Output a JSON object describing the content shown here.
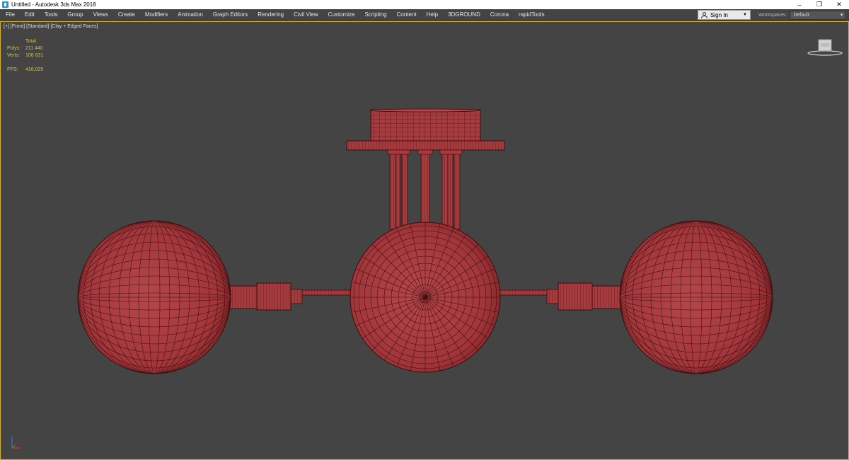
{
  "window": {
    "title": "Untitled - Autodesk 3ds Max 2018",
    "controls": [
      "–",
      "❐",
      "✕"
    ]
  },
  "menu": [
    "File",
    "Edit",
    "Tools",
    "Group",
    "Views",
    "Create",
    "Modifiers",
    "Animation",
    "Graph Editors",
    "Rendering",
    "Civil View",
    "Customize",
    "Scripting",
    "Content",
    "Help",
    "3DGROUND",
    "Corona",
    "rapidTools"
  ],
  "signin": {
    "label": "Sign In"
  },
  "workspaces": {
    "label": "Workspaces:",
    "value": "Default"
  },
  "viewport": {
    "label": "[+] [Front] [Standard] [Clay + Edged Faces]",
    "stats": {
      "header": "Total",
      "polys_label": "Polys:",
      "polys": "211 440",
      "verts_label": "Verts:",
      "verts": "106 631",
      "fps_label": "FPS:",
      "fps": "416,025"
    }
  },
  "colors": {
    "accent_border": "#d9b024",
    "mesh_fill": "#a8393c",
    "mesh_wire": "#3a0d0e",
    "viewport_bg": "#444444"
  },
  "icons": [
    "autodesk-3dsmax-icon",
    "user-icon",
    "viewcube-icon",
    "axis-tripod-icon"
  ]
}
